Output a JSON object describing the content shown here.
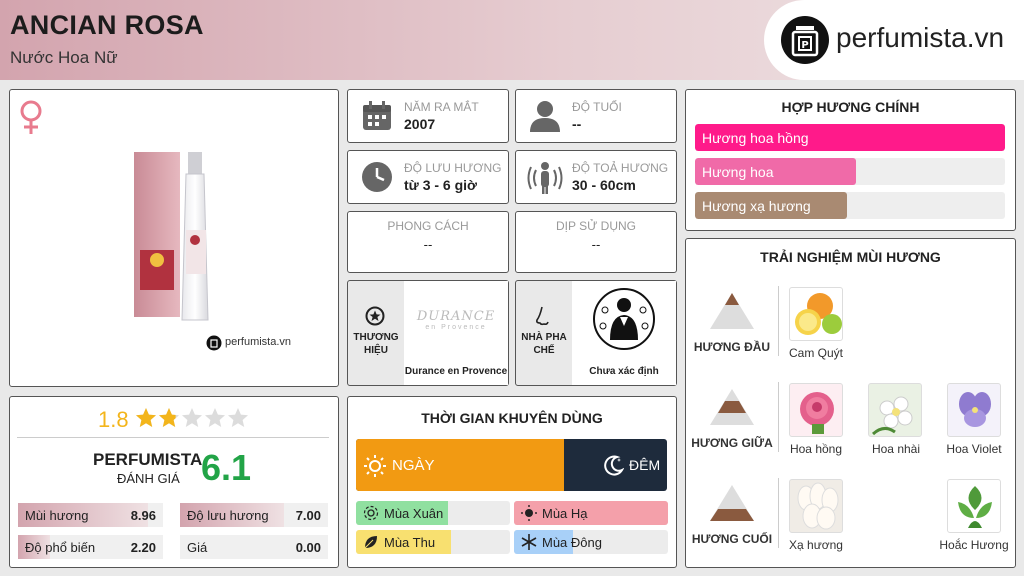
{
  "product": {
    "name": "ANCIAN ROSA",
    "subtitle": "Nước Hoa Nữ"
  },
  "site": {
    "logo_text": "perfumista.vn",
    "watermark": "perfumista.vn"
  },
  "gender_icon": "female-icon",
  "info": {
    "year": {
      "label": "NĂM RA MẮT",
      "value": "2007"
    },
    "age": {
      "label": "ĐỘ TUỔI",
      "value": "--"
    },
    "longevity": {
      "label": "ĐỘ LƯU HƯƠNG",
      "value": "từ 3 - 6 giờ"
    },
    "sillage": {
      "label": "ĐỘ TOẢ HƯƠNG",
      "value": "30 - 60cm"
    },
    "style": {
      "label": "PHONG CÁCH",
      "value": "--"
    },
    "occasion": {
      "label": "DỊP SỬ DỤNG",
      "value": "--"
    },
    "brand": {
      "label_line1": "THƯƠNG",
      "label_line2": "HIỆU",
      "name": "Durance en Provence",
      "logo_line1": "DURANCE",
      "logo_line2": "en Provence"
    },
    "perfumer": {
      "label_line1": "NHÀ PHA",
      "label_line2": "CHẾ",
      "name": "Chưa xác định"
    }
  },
  "rating": {
    "score": "1.8",
    "stars_out_of_5": 1.8,
    "perfumista_label": "PERFUMISTA",
    "evaluation_label": "ĐÁNH GIÁ",
    "perfumista_score": "6.1",
    "stats": [
      {
        "label": "Mùi hương",
        "value": "8.96",
        "fraction": 0.896
      },
      {
        "label": "Độ lưu hương",
        "value": "7.00",
        "fraction": 0.7
      },
      {
        "label": "Độ phổ biến",
        "value": "2.20",
        "fraction": 0.22
      },
      {
        "label": "Giá",
        "value": "0.00",
        "fraction": 0.0
      }
    ]
  },
  "time_of_use": {
    "title": "THỜI GIAN KHUYÊN DÙNG",
    "day_label": "NGÀY",
    "night_label": "ĐÊM",
    "day_fraction": 0.67,
    "seasons": [
      {
        "label": "Mùa Xuân",
        "fraction": 0.6,
        "color": "#90e0a0"
      },
      {
        "label": "Mùa Hạ",
        "fraction": 1.0,
        "color": "#f4a0aa"
      },
      {
        "label": "Mùa Thu",
        "fraction": 0.62,
        "color": "#f8e070"
      },
      {
        "label": "Mùa Đông",
        "fraction": 0.38,
        "color": "#a8d0f8"
      }
    ]
  },
  "accords": {
    "title": "HỢP HƯƠNG CHÍNH",
    "items": [
      {
        "label": "Hương hoa hồng",
        "fraction": 1.0,
        "color": "#ff1a8a"
      },
      {
        "label": "Hương hoa",
        "fraction": 0.52,
        "color": "#f06aa8"
      },
      {
        "label": "Hương xạ hương",
        "fraction": 0.49,
        "color": "#a98a72"
      }
    ]
  },
  "notes": {
    "title": "TRẢI NGHIỆM MÙI HƯƠNG",
    "top": {
      "label": "HƯƠNG ĐẦU",
      "items": [
        {
          "name": "Cam Quýt",
          "icon": "citrus-icon"
        }
      ]
    },
    "middle": {
      "label": "HƯƠNG GIỮA",
      "items": [
        {
          "name": "Hoa hồng",
          "icon": "rose-icon"
        },
        {
          "name": "Hoa nhài",
          "icon": "jasmine-icon"
        },
        {
          "name": "Hoa Violet",
          "icon": "violet-icon"
        }
      ]
    },
    "base": {
      "label": "HƯƠNG CUỐI",
      "items": [
        {
          "name": "Xạ hương",
          "icon": "musk-icon"
        },
        {
          "name": "Hoắc Hương",
          "icon": "patchouli-icon"
        }
      ]
    }
  }
}
